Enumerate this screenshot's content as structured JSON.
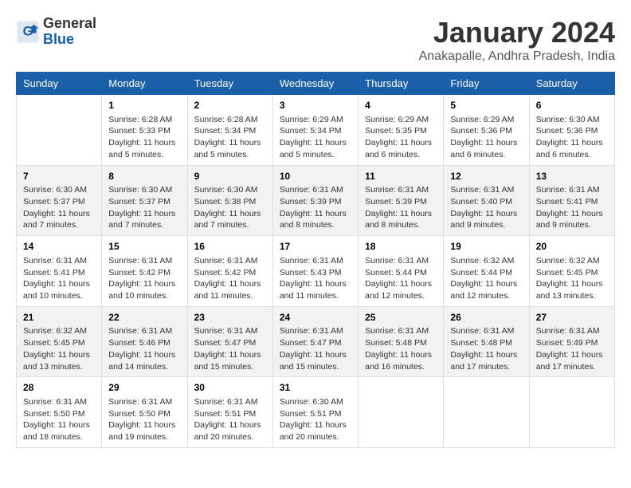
{
  "header": {
    "logo_line1": "General",
    "logo_line2": "Blue",
    "title": "January 2024",
    "subtitle": "Anakapalle, Andhra Pradesh, India"
  },
  "days_of_week": [
    "Sunday",
    "Monday",
    "Tuesday",
    "Wednesday",
    "Thursday",
    "Friday",
    "Saturday"
  ],
  "weeks": [
    [
      {
        "num": "",
        "sunrise": "",
        "sunset": "",
        "daylight": ""
      },
      {
        "num": "1",
        "sunrise": "Sunrise: 6:28 AM",
        "sunset": "Sunset: 5:33 PM",
        "daylight": "Daylight: 11 hours and 5 minutes."
      },
      {
        "num": "2",
        "sunrise": "Sunrise: 6:28 AM",
        "sunset": "Sunset: 5:34 PM",
        "daylight": "Daylight: 11 hours and 5 minutes."
      },
      {
        "num": "3",
        "sunrise": "Sunrise: 6:29 AM",
        "sunset": "Sunset: 5:34 PM",
        "daylight": "Daylight: 11 hours and 5 minutes."
      },
      {
        "num": "4",
        "sunrise": "Sunrise: 6:29 AM",
        "sunset": "Sunset: 5:35 PM",
        "daylight": "Daylight: 11 hours and 6 minutes."
      },
      {
        "num": "5",
        "sunrise": "Sunrise: 6:29 AM",
        "sunset": "Sunset: 5:36 PM",
        "daylight": "Daylight: 11 hours and 6 minutes."
      },
      {
        "num": "6",
        "sunrise": "Sunrise: 6:30 AM",
        "sunset": "Sunset: 5:36 PM",
        "daylight": "Daylight: 11 hours and 6 minutes."
      }
    ],
    [
      {
        "num": "7",
        "sunrise": "Sunrise: 6:30 AM",
        "sunset": "Sunset: 5:37 PM",
        "daylight": "Daylight: 11 hours and 7 minutes."
      },
      {
        "num": "8",
        "sunrise": "Sunrise: 6:30 AM",
        "sunset": "Sunset: 5:37 PM",
        "daylight": "Daylight: 11 hours and 7 minutes."
      },
      {
        "num": "9",
        "sunrise": "Sunrise: 6:30 AM",
        "sunset": "Sunset: 5:38 PM",
        "daylight": "Daylight: 11 hours and 7 minutes."
      },
      {
        "num": "10",
        "sunrise": "Sunrise: 6:31 AM",
        "sunset": "Sunset: 5:39 PM",
        "daylight": "Daylight: 11 hours and 8 minutes."
      },
      {
        "num": "11",
        "sunrise": "Sunrise: 6:31 AM",
        "sunset": "Sunset: 5:39 PM",
        "daylight": "Daylight: 11 hours and 8 minutes."
      },
      {
        "num": "12",
        "sunrise": "Sunrise: 6:31 AM",
        "sunset": "Sunset: 5:40 PM",
        "daylight": "Daylight: 11 hours and 9 minutes."
      },
      {
        "num": "13",
        "sunrise": "Sunrise: 6:31 AM",
        "sunset": "Sunset: 5:41 PM",
        "daylight": "Daylight: 11 hours and 9 minutes."
      }
    ],
    [
      {
        "num": "14",
        "sunrise": "Sunrise: 6:31 AM",
        "sunset": "Sunset: 5:41 PM",
        "daylight": "Daylight: 11 hours and 10 minutes."
      },
      {
        "num": "15",
        "sunrise": "Sunrise: 6:31 AM",
        "sunset": "Sunset: 5:42 PM",
        "daylight": "Daylight: 11 hours and 10 minutes."
      },
      {
        "num": "16",
        "sunrise": "Sunrise: 6:31 AM",
        "sunset": "Sunset: 5:42 PM",
        "daylight": "Daylight: 11 hours and 11 minutes."
      },
      {
        "num": "17",
        "sunrise": "Sunrise: 6:31 AM",
        "sunset": "Sunset: 5:43 PM",
        "daylight": "Daylight: 11 hours and 11 minutes."
      },
      {
        "num": "18",
        "sunrise": "Sunrise: 6:31 AM",
        "sunset": "Sunset: 5:44 PM",
        "daylight": "Daylight: 11 hours and 12 minutes."
      },
      {
        "num": "19",
        "sunrise": "Sunrise: 6:32 AM",
        "sunset": "Sunset: 5:44 PM",
        "daylight": "Daylight: 11 hours and 12 minutes."
      },
      {
        "num": "20",
        "sunrise": "Sunrise: 6:32 AM",
        "sunset": "Sunset: 5:45 PM",
        "daylight": "Daylight: 11 hours and 13 minutes."
      }
    ],
    [
      {
        "num": "21",
        "sunrise": "Sunrise: 6:32 AM",
        "sunset": "Sunset: 5:45 PM",
        "daylight": "Daylight: 11 hours and 13 minutes."
      },
      {
        "num": "22",
        "sunrise": "Sunrise: 6:31 AM",
        "sunset": "Sunset: 5:46 PM",
        "daylight": "Daylight: 11 hours and 14 minutes."
      },
      {
        "num": "23",
        "sunrise": "Sunrise: 6:31 AM",
        "sunset": "Sunset: 5:47 PM",
        "daylight": "Daylight: 11 hours and 15 minutes."
      },
      {
        "num": "24",
        "sunrise": "Sunrise: 6:31 AM",
        "sunset": "Sunset: 5:47 PM",
        "daylight": "Daylight: 11 hours and 15 minutes."
      },
      {
        "num": "25",
        "sunrise": "Sunrise: 6:31 AM",
        "sunset": "Sunset: 5:48 PM",
        "daylight": "Daylight: 11 hours and 16 minutes."
      },
      {
        "num": "26",
        "sunrise": "Sunrise: 6:31 AM",
        "sunset": "Sunset: 5:48 PM",
        "daylight": "Daylight: 11 hours and 17 minutes."
      },
      {
        "num": "27",
        "sunrise": "Sunrise: 6:31 AM",
        "sunset": "Sunset: 5:49 PM",
        "daylight": "Daylight: 11 hours and 17 minutes."
      }
    ],
    [
      {
        "num": "28",
        "sunrise": "Sunrise: 6:31 AM",
        "sunset": "Sunset: 5:50 PM",
        "daylight": "Daylight: 11 hours and 18 minutes."
      },
      {
        "num": "29",
        "sunrise": "Sunrise: 6:31 AM",
        "sunset": "Sunset: 5:50 PM",
        "daylight": "Daylight: 11 hours and 19 minutes."
      },
      {
        "num": "30",
        "sunrise": "Sunrise: 6:31 AM",
        "sunset": "Sunset: 5:51 PM",
        "daylight": "Daylight: 11 hours and 20 minutes."
      },
      {
        "num": "31",
        "sunrise": "Sunrise: 6:30 AM",
        "sunset": "Sunset: 5:51 PM",
        "daylight": "Daylight: 11 hours and 20 minutes."
      },
      {
        "num": "",
        "sunrise": "",
        "sunset": "",
        "daylight": ""
      },
      {
        "num": "",
        "sunrise": "",
        "sunset": "",
        "daylight": ""
      },
      {
        "num": "",
        "sunrise": "",
        "sunset": "",
        "daylight": ""
      }
    ]
  ]
}
